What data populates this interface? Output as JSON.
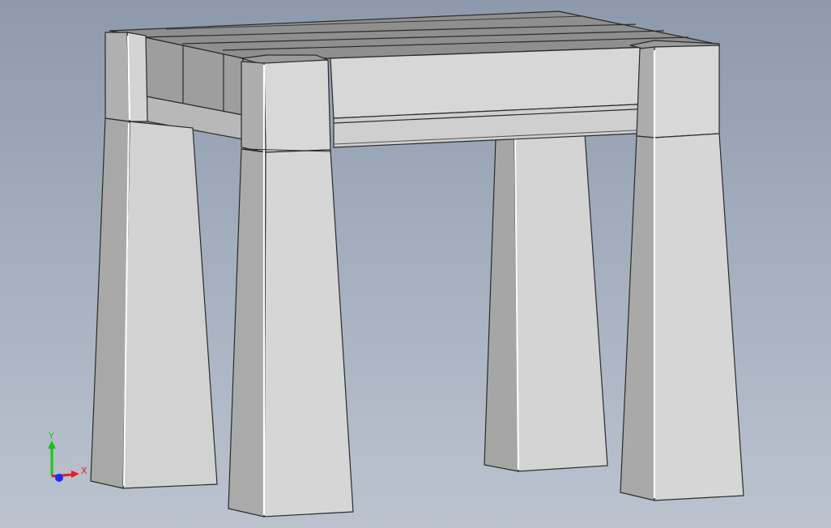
{
  "viewport": {
    "background_top": "#8e99ad",
    "background_bottom": "#bcc3cf"
  },
  "model": {
    "face_light": "#d6d6d6",
    "face_mid": "#bdbdbd",
    "face_dark": "#9a9a9a",
    "top_face": "#8f8f8f",
    "edge": "#2a2a2a",
    "highlight": "#ffffff"
  },
  "triad": {
    "y_label": "Y",
    "x_label": "X",
    "y_color": "#19c419",
    "x_color": "#e02020",
    "z_color": "#1a2cff"
  }
}
